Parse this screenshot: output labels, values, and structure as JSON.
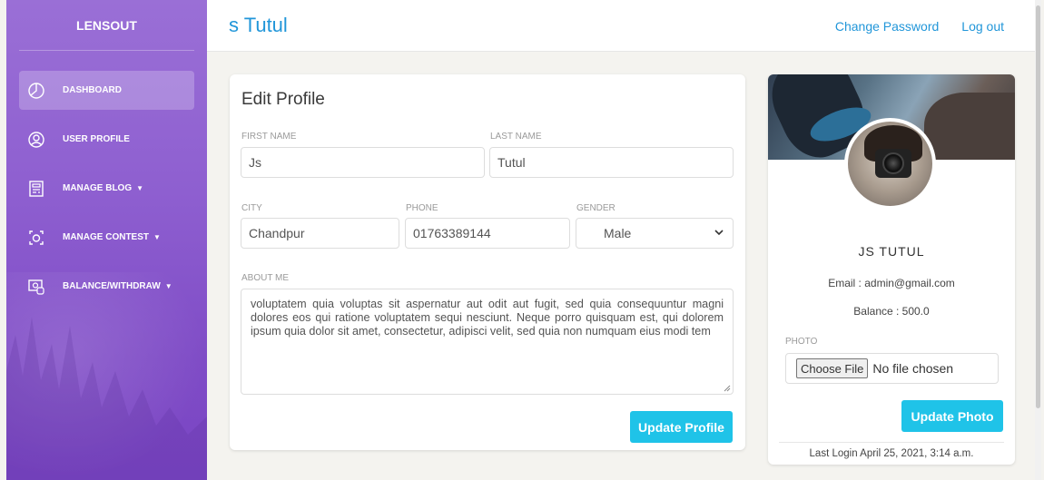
{
  "sidebar": {
    "logo": "LENSOUT",
    "items": [
      {
        "label": "DASHBOARD",
        "icon": "pie-chart-icon",
        "active": true,
        "dropdown": false
      },
      {
        "label": "USER PROFILE",
        "icon": "user-icon",
        "active": false,
        "dropdown": false
      },
      {
        "label": "MANAGE BLOG",
        "icon": "blog-icon",
        "active": false,
        "dropdown": true
      },
      {
        "label": "MANAGE CONTEST",
        "icon": "camera-icon",
        "active": false,
        "dropdown": true
      },
      {
        "label": "BALANCE/WITHDRAW",
        "icon": "money-icon",
        "active": false,
        "dropdown": true
      }
    ],
    "gradient_top": "#9a6fd6",
    "gradient_bottom": "#7a45c4"
  },
  "topbar": {
    "title": "s Tutul",
    "links": [
      "Change Password",
      "Log out"
    ]
  },
  "edit_profile": {
    "title": "Edit Profile",
    "first_name": {
      "label": "FIRST NAME",
      "value": "Js"
    },
    "last_name": {
      "label": "LAST NAME",
      "value": "Tutul"
    },
    "city": {
      "label": "CITY",
      "value": "Chandpur"
    },
    "phone": {
      "label": "PHONE",
      "value": "01763389144"
    },
    "gender": {
      "label": "GENDER",
      "value": "Male"
    },
    "about": {
      "label": "ABOUT ME",
      "value": "voluptatem quia voluptas sit aspernatur aut odit aut fugit, sed quia consequuntur magni dolores eos qui ratione voluptatem sequi nesciunt. Neque porro quisquam est, qui dolorem ipsum quia dolor sit amet, consectetur, adipisci velit, sed quia non numquam eius modi tem"
    },
    "submit_label": "Update Profile"
  },
  "user_card": {
    "name": "JS TUTUL",
    "email": "Email : admin@gmail.com",
    "balance": "Balance : 500.0",
    "photo_label": "PHOTO",
    "choose_file_label": "Choose File",
    "no_file_text": "No file chosen",
    "update_photo_label": "Update Photo",
    "last_login": "Last Login April 25, 2021, 3:14 a.m."
  },
  "colors": {
    "accent": "#1fc3e8",
    "link": "#2196d9"
  }
}
